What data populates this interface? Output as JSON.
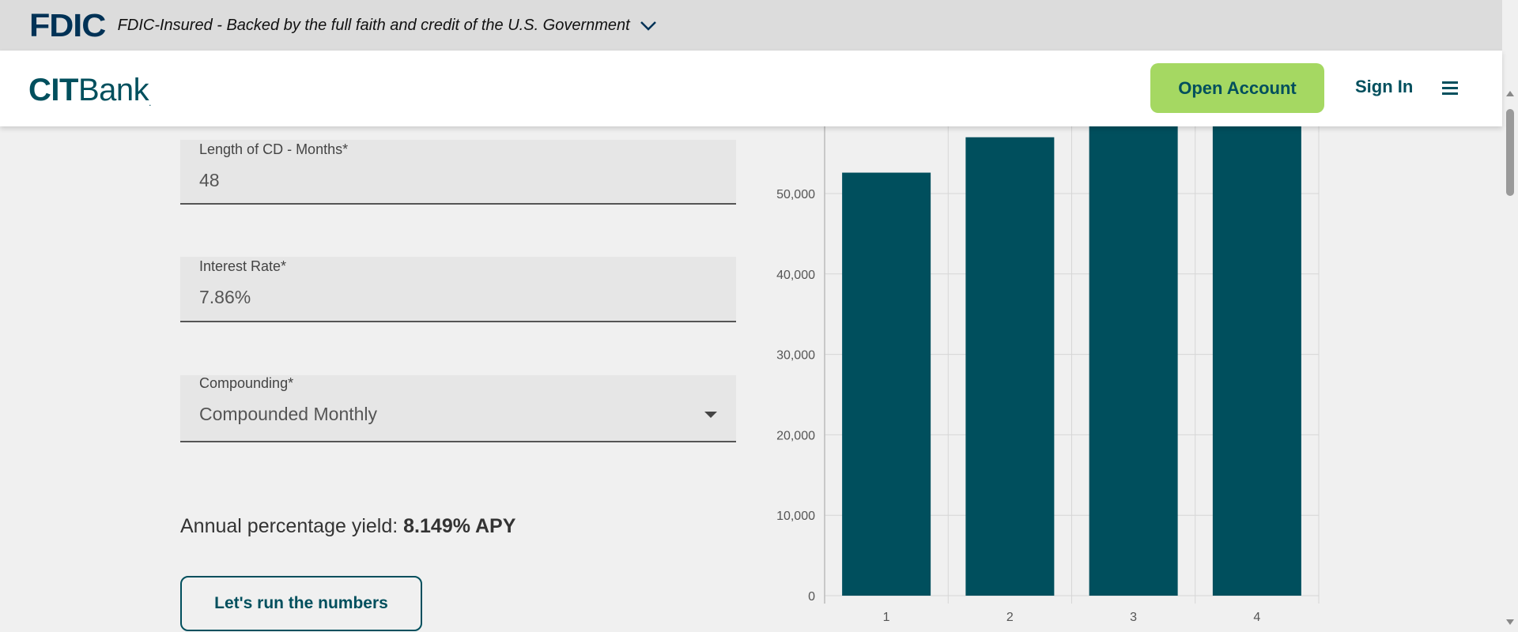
{
  "fdic": {
    "logo": "FDIC",
    "text": "FDIC-Insured - Backed by the full faith and credit of the U.S. Government",
    "toggle_icon": "chevron-down-icon"
  },
  "header": {
    "brand_cit": "CIT",
    "brand_bank": "Bank",
    "brand_mark": ".",
    "open_account": "Open Account",
    "sign_in": "Sign In",
    "menu_icon": "hamburger-menu-icon"
  },
  "form": {
    "cd_length": {
      "label": "Length of CD - Months*",
      "value": "48"
    },
    "interest_rate": {
      "label": "Interest Rate*",
      "value": "7.86%"
    },
    "compounding": {
      "label": "Compounding*",
      "value": "Compounded Monthly",
      "icon": "caret-down-icon"
    },
    "apy_label": "Annual percentage yield:",
    "apy_value": "8.149% APY",
    "run_button": "Let's run the numbers"
  },
  "colors": {
    "brand_teal": "#004f5d",
    "accent_green": "#a5d862",
    "fdic_navy": "#003256"
  },
  "chart_data": {
    "type": "bar",
    "categories": [
      "1",
      "2",
      "3",
      "4"
    ],
    "values": [
      52600,
      57000,
      61700,
      66900
    ],
    "ylim": [
      0,
      60000
    ],
    "yticks": [
      "0",
      "10,000",
      "20,000",
      "30,000",
      "40,000",
      "50,000"
    ],
    "ytick_values": [
      0,
      10000,
      20000,
      30000,
      40000,
      50000
    ],
    "grid": true,
    "color": "#004f5d"
  }
}
